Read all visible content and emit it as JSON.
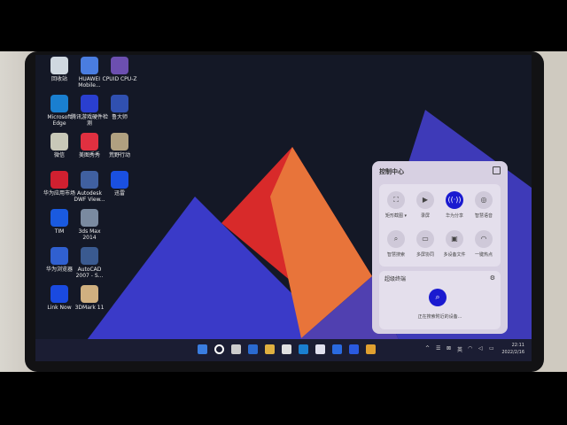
{
  "desktop_icons": [
    {
      "label": "回收站",
      "color": "#cfd8e0"
    },
    {
      "label": "HUAWEI Mobile...",
      "color": "#4a7de0"
    },
    {
      "label": "CPUID CPU-Z",
      "color": "#6c4fb0"
    },
    {
      "label": "Microsoft Edge",
      "color": "#1a7fd0"
    },
    {
      "label": "腾讯游戏硬件检测",
      "color": "#2a3fd0"
    },
    {
      "label": "鲁大师",
      "color": "#3050b0"
    },
    {
      "label": "微信",
      "color": "#c8c8b8"
    },
    {
      "label": "美图秀秀",
      "color": "#e03040"
    },
    {
      "label": "荒野行动",
      "color": "#b0a080"
    },
    {
      "label": "华为应用市场",
      "color": "#d02030"
    },
    {
      "label": "Autodesk DWF View...",
      "color": "#4060a0"
    },
    {
      "label": "迅雷",
      "color": "#1a50e0"
    },
    {
      "label": "TIM",
      "color": "#1a5ae0"
    },
    {
      "label": "3ds Max 2014",
      "color": "#7a8aa0"
    },
    {
      "label": "",
      "color": "#000"
    },
    {
      "label": "华为浏览器",
      "color": "#3060d0"
    },
    {
      "label": "AutoCAD 2007 - S...",
      "color": "#3a5a90"
    },
    {
      "label": "",
      "color": "#000"
    },
    {
      "label": "Link Now",
      "color": "#1a4ae0"
    },
    {
      "label": "3DMark 11",
      "color": "#d0b080"
    }
  ],
  "control_center": {
    "title": "控制中心",
    "tiles": [
      {
        "label": "矩形截图 ▾",
        "icon": "screenshot-icon",
        "glyph": "⛶",
        "active": false
      },
      {
        "label": "录屏",
        "icon": "record-icon",
        "glyph": "▶",
        "active": false
      },
      {
        "label": "华为分享",
        "icon": "share-icon",
        "glyph": "((·))",
        "active": true
      },
      {
        "label": "智慧语音",
        "icon": "voice-icon",
        "glyph": "◎",
        "active": false
      },
      {
        "label": "智慧搜索",
        "icon": "search-icon",
        "glyph": "⌕",
        "active": false
      },
      {
        "label": "多屏协同",
        "icon": "multiscreen-icon",
        "glyph": "▭",
        "active": false
      },
      {
        "label": "多设备文件",
        "icon": "folder-icon",
        "glyph": "▣",
        "active": false
      },
      {
        "label": "一键热点",
        "icon": "hotspot-icon",
        "glyph": "◠",
        "active": false
      }
    ],
    "super_device": {
      "title": "超级终端",
      "status": "正在搜索附近的设备..."
    }
  },
  "taskbar": {
    "apps": [
      "#3a7de0",
      "#ffffff",
      "#cccccc",
      "#2a6ad0",
      "#e0b040",
      "#e0e0e0",
      "#1a7fd0",
      "#e0e0ee",
      "#2a6ae0",
      "#2a5ae0",
      "#e0a030"
    ],
    "tray": [
      "^",
      "☰",
      "⊠",
      "英",
      "◠",
      "◁",
      "▭"
    ],
    "time": "22:11",
    "date": "2022/2/16"
  }
}
